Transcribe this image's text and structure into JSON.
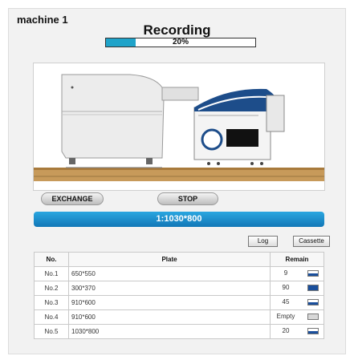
{
  "machine": {
    "title": "machine 1"
  },
  "status": {
    "title": "Recording",
    "progress_text": "20%",
    "progress_fraction": 0.2
  },
  "buttons": {
    "exchange": "EXCHANGE",
    "stop": "STOP",
    "log": "Log",
    "cassette": "Cassette"
  },
  "current_size": "1:1030*800",
  "table": {
    "headers": {
      "no": "No.",
      "plate": "Plate",
      "remain": "Remain"
    },
    "rows": [
      {
        "no": "No.1",
        "plate": "650*550",
        "remain": "9",
        "icon": "plate-half-icon"
      },
      {
        "no": "No.2",
        "plate": "300*370",
        "remain": "90",
        "icon": "plate-full-icon"
      },
      {
        "no": "No.3",
        "plate": "910*600",
        "remain": "45",
        "icon": "plate-half-icon"
      },
      {
        "no": "No.4",
        "plate": "910*600",
        "remain": "Empty",
        "icon": "plate-empty-icon"
      },
      {
        "no": "No.5",
        "plate": "1030*800",
        "remain": "20",
        "icon": "plate-half-icon"
      }
    ]
  },
  "colors": {
    "progress": "#1fa3c9",
    "size_bar": "#1a8fd0",
    "plate_full": "#1a4f9c",
    "plate_empty": "#d8d8d8"
  }
}
